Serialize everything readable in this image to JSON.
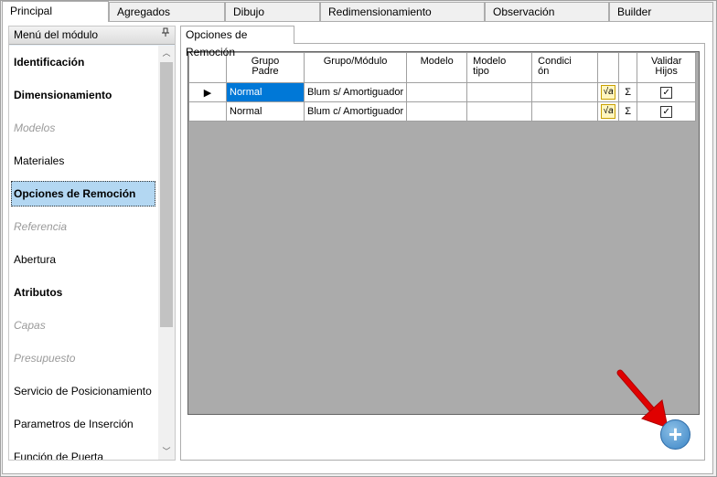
{
  "tabs": [
    {
      "label": "Principal",
      "active": true
    },
    {
      "label": "Agregados"
    },
    {
      "label": "Dibujo"
    },
    {
      "label": "Redimensionamiento"
    },
    {
      "label": "Observación"
    },
    {
      "label": "Builder"
    }
  ],
  "left_panel": {
    "title": "Menú del módulo",
    "pin_icon": "pin-icon",
    "items": [
      {
        "label": "Identificación",
        "style": "bold"
      },
      {
        "label": "Dimensionamiento",
        "style": "bold"
      },
      {
        "label": "Modelos",
        "style": "disabled"
      },
      {
        "label": "Materiales",
        "style": "normal"
      },
      {
        "label": "Opciones de Remoción",
        "style": "selected"
      },
      {
        "label": "Referencia",
        "style": "disabled"
      },
      {
        "label": "Abertura",
        "style": "normal"
      },
      {
        "label": "Atributos",
        "style": "bold"
      },
      {
        "label": "Capas",
        "style": "disabled"
      },
      {
        "label": "Presupuesto",
        "style": "disabled"
      },
      {
        "label": "Servicio de Posicionamiento",
        "style": "normal"
      },
      {
        "label": "Parametros de Inserción",
        "style": "normal"
      },
      {
        "label": "Función de Puerta",
        "style": "normal"
      }
    ]
  },
  "inner_tab": {
    "label": "Opciones de Remoción"
  },
  "grid": {
    "columns": {
      "grupo_padre": "Grupo\nPadre",
      "grupo_modulo": "Grupo/Módulo",
      "modelo": "Modelo",
      "modelo_tipo": "Modelo\ntipo",
      "condicion": "Condici\nón",
      "validar_hijos": "Validar\nHijos"
    },
    "rows": [
      {
        "grupo_padre": "Normal",
        "grupo_modulo": "Blum s/ Amortiguador",
        "modelo": "",
        "modelo_tipo": "",
        "condicion": "",
        "validar_hijos": true,
        "current": true
      },
      {
        "grupo_padre": "Normal",
        "grupo_modulo": "Blum c/ Amortiguador",
        "modelo": "",
        "modelo_tipo": "",
        "condicion": "",
        "validar_hijos": true,
        "current": false
      }
    ],
    "formula_icon": "sqrt-formula-icon",
    "sum_glyph": "Σ",
    "check_glyph": "✓",
    "row_pointer_glyph": "▶"
  },
  "add_button": {
    "glyph": "+",
    "icon": "add-icon"
  },
  "colors": {
    "selected_cell": "#0078d7",
    "grid_bg": "#ababab",
    "panel_bg": "#e8f1fa",
    "arrow": "#e00000"
  }
}
